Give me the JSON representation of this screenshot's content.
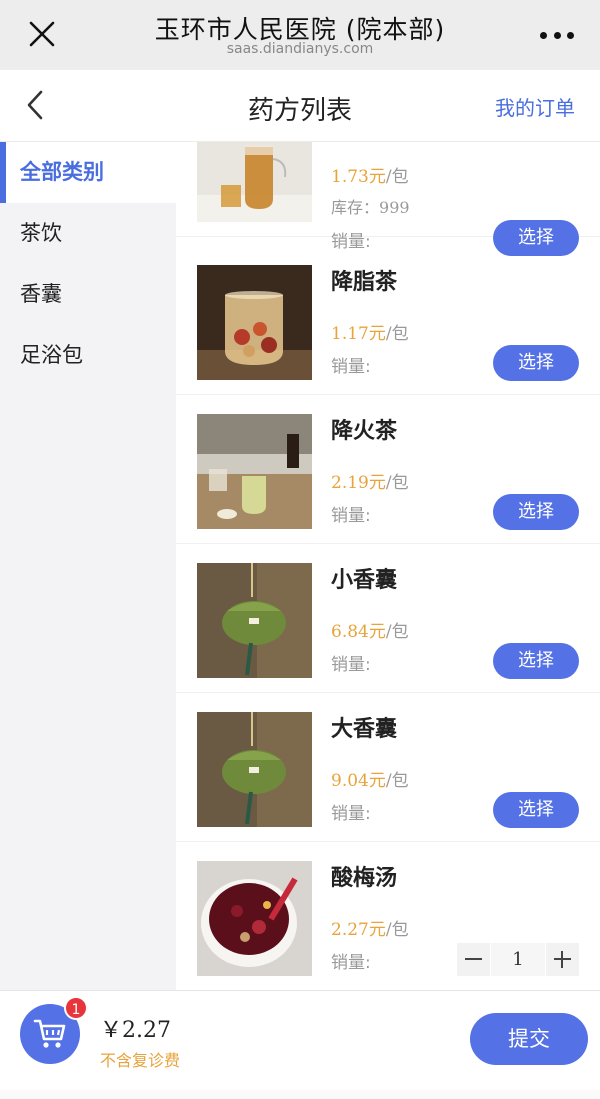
{
  "browser": {
    "title": "玉环市人民医院 (院本部)",
    "domain": "saas.diandianys.com"
  },
  "header": {
    "title": "药方列表",
    "orders_link": "我的订单"
  },
  "sidebar": {
    "items": [
      {
        "label": "全部类别",
        "active": true
      },
      {
        "label": "茶饮"
      },
      {
        "label": "香囊"
      },
      {
        "label": "足浴包"
      }
    ]
  },
  "products": [
    {
      "name": "",
      "price": "1.73元",
      "unit": "/包",
      "stock_label": "库存：",
      "stock_value": "999",
      "sales_label": "销量:",
      "action": "选择"
    },
    {
      "name": "降脂茶",
      "price": "1.17元",
      "unit": "/包",
      "sales_label": "销量:",
      "action": "选择"
    },
    {
      "name": "降火茶",
      "price": "2.19元",
      "unit": "/包",
      "sales_label": "销量:",
      "action": "选择"
    },
    {
      "name": "小香囊",
      "price": "6.84元",
      "unit": "/包",
      "sales_label": "销量:",
      "action": "选择"
    },
    {
      "name": "大香囊",
      "price": "9.04元",
      "unit": "/包",
      "sales_label": "销量:",
      "action": "选择"
    },
    {
      "name": "酸梅汤",
      "price": "2.27元",
      "unit": "/包",
      "sales_label": "销量:",
      "quantity": "1"
    }
  ],
  "cart": {
    "badge": "1",
    "total": "￥2.27",
    "note": "不含复诊费",
    "submit": "提交"
  },
  "colors": {
    "accent": "#5471e6",
    "price": "#e8a33b",
    "badge": "#e8343b"
  }
}
